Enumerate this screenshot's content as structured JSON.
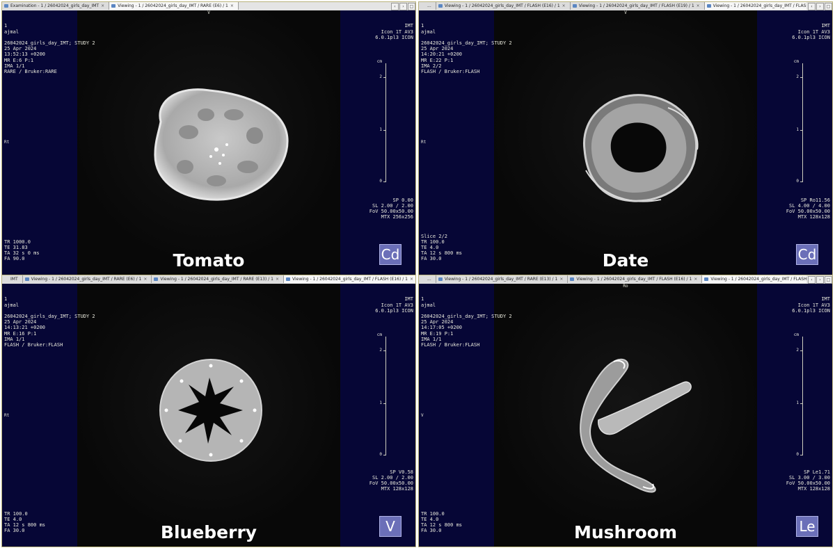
{
  "panels": [
    {
      "id": "tomato",
      "tabs": [
        {
          "label": "Examination - 1 / 26042024_girls_day_IMT",
          "active": false
        },
        {
          "label": "Viewing - 1 / 26042024_girls_day_IMT / RARE (E6) / 1",
          "active": true
        }
      ],
      "window_buttons": [
        "‹",
        "›",
        "□"
      ],
      "orientation_top": "V",
      "orientation_left": "Rt",
      "info_left": [
        "1",
        "ajmal",
        "",
        "26042024_girls_day_IMT; STUDY 2",
        "25 Apr 2024",
        "13:52:13 +0200",
        "MR E:6 P:1",
        "IMA 1/1",
        "RARE / Bruker:RARE"
      ],
      "info_right": [
        "IMT",
        "Icon 1T AV3",
        "6.0.1pl3 ICON"
      ],
      "params_right": [
        "SP 0.00",
        "SL 2.00 / 2.00",
        "FoV 50.00x50.00",
        "MTX 256x256"
      ],
      "params_left": [
        "TR 1000.0",
        "TE 31.83",
        "TA 32 s 0 ms",
        "FA 90.0"
      ],
      "scale_unit": "cm",
      "scale_ticks": [
        "2",
        "1",
        "0"
      ],
      "orientation_cube": "Cd",
      "title": "Tomato"
    },
    {
      "id": "date",
      "tabs": [
        {
          "label": "...",
          "active": false
        },
        {
          "label": "Viewing - 1 / 26042024_girls_day_IMT / FLASH (E16) / 1",
          "active": false
        },
        {
          "label": "Viewing - 1 / 26042024_girls_day_IMT / FLASH (E19) / 1",
          "active": false
        },
        {
          "label": "Viewing - 1 / 26042024_girls_day_IMT / FLASH (E22) / 1",
          "active": true
        }
      ],
      "window_buttons": [
        "‹",
        "›",
        "□"
      ],
      "orientation_top": "V",
      "orientation_left": "Rt",
      "info_left": [
        "1",
        "ajmal",
        "",
        "26042024_girls_day_IMT; STUDY 2",
        "25 Apr 2024",
        "14:20:21 +0200",
        "MR E:22 P:1",
        "IMA 2/2",
        "FLASH / Bruker:FLASH"
      ],
      "info_right": [
        "IMT",
        "Icon 1T AV3",
        "6.0.1pl3 ICON"
      ],
      "params_right": [
        "SP Ro11.56",
        "SL 4.00 / 4.00",
        "FoV 50.00x50.00",
        "MTX 128x128"
      ],
      "params_left": [
        "Slice 2/2",
        "TR 100.0",
        "TE 4.0",
        "TA 12 s 800 ms",
        "FA 30.0"
      ],
      "scale_unit": "cm",
      "scale_ticks": [
        "2",
        "1",
        "0"
      ],
      "orientation_cube": "Cd",
      "title": "Date"
    },
    {
      "id": "blueberry",
      "tabs": [
        {
          "label": "IMT",
          "active": false
        },
        {
          "label": "Viewing - 1 / 26042024_girls_day_IMT / RARE (E6) / 1",
          "active": false
        },
        {
          "label": "Viewing - 1 / 26042024_girls_day_IMT / RARE (E13) / 1",
          "active": false
        },
        {
          "label": "Viewing - 1 / 26042024_girls_day_IMT / FLASH (E16) / 1",
          "active": true
        }
      ],
      "window_buttons": [],
      "orientation_top": "",
      "orientation_left": "Rt",
      "info_left": [
        "1",
        "ajmal",
        "",
        "26042024_girls_day_IMT; STUDY 2",
        "25 Apr 2024",
        "14:13:21 +0200",
        "MR E:16 P:1",
        "IMA 1/1",
        "FLASH / Bruker:FLASH"
      ],
      "info_right": [
        "IMT",
        "Icon 1T AV3",
        "6.0.1pl3 ICON"
      ],
      "params_right": [
        "SP V0.58",
        "SL 2.00 / 2.00",
        "FoV 50.00x50.00",
        "MTX 128x128"
      ],
      "params_left": [
        "TR 100.0",
        "TE 4.0",
        "TA 12 s 800 ms",
        "FA 30.0"
      ],
      "scale_unit": "cm",
      "scale_ticks": [
        "2",
        "1",
        "0"
      ],
      "orientation_cube": "V",
      "title": "Blueberry"
    },
    {
      "id": "mushroom",
      "tabs": [
        {
          "label": "...",
          "active": false
        },
        {
          "label": "Viewing - 1 / 26042024_girls_day_IMT / RARE (E13) / 1",
          "active": false
        },
        {
          "label": "Viewing - 1 / 26042024_girls_day_IMT / FLASH (E16) / 1",
          "active": false
        },
        {
          "label": "Viewing - 1 / 26042024_girls_day_IMT / FLASH (E19) / 1",
          "active": true
        }
      ],
      "window_buttons": [
        "‹",
        "›",
        "□"
      ],
      "orientation_top": "Ro",
      "orientation_left": "V",
      "info_left": [
        "1",
        "ajmal",
        "",
        "26042024_girls_day_IMT; STUDY 2",
        "25 Apr 2024",
        "14:17:05 +0200",
        "MR E:19 P:1",
        "IMA 1/1",
        "FLASH / Bruker:FLASH"
      ],
      "info_right": [
        "IMT",
        "Icon 1T AV3",
        "6.0.1pl3 ICON"
      ],
      "params_right": [
        "SP Le1.71",
        "SL 3.00 / 3.00",
        "FoV 50.00x50.00",
        "MTX 128x128"
      ],
      "params_left": [
        "TR 100.0",
        "TE 4.0",
        "TA 12 s 800 ms",
        "FA 30.0"
      ],
      "scale_unit": "cm",
      "scale_ticks": [
        "2",
        "1",
        "0"
      ],
      "orientation_cube": "Le",
      "title": "Mushroom"
    }
  ],
  "colors": {
    "side_band": "#060636",
    "background": "#050505",
    "overlay_text": "#e8e8dc",
    "orientation_cube": "#6b6fb8",
    "title_text": "#ffffff"
  }
}
